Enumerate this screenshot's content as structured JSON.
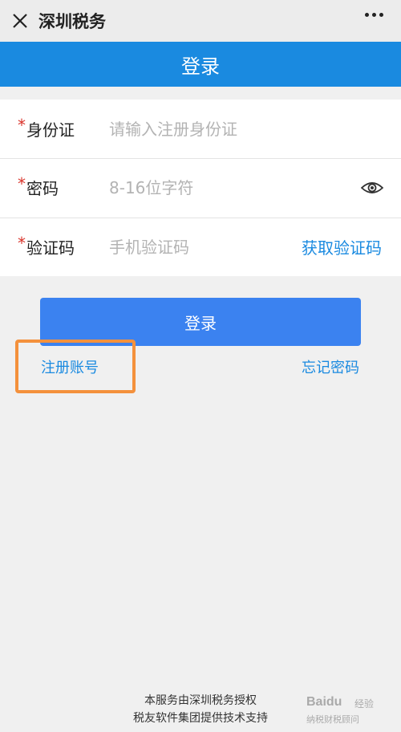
{
  "topbar": {
    "title": "深圳税务"
  },
  "header": {
    "title": "登录"
  },
  "form": {
    "id_label": "身份证",
    "id_placeholder": "请输入注册身份证",
    "password_label": "密码",
    "password_placeholder": "8-16位字符",
    "code_label": "验证码",
    "code_placeholder": "手机验证码",
    "get_code": "获取验证码",
    "required_mark": "*"
  },
  "actions": {
    "login": "登录",
    "register": "注册账号",
    "forgot": "忘记密码"
  },
  "footer": {
    "line1": "本服务由深圳税务授权",
    "line2": "税友软件集团提供技术支持"
  },
  "watermark": {
    "line1": "Baidu",
    "line2": "经验",
    "line3": "纳税财税顾问"
  },
  "colors": {
    "header": "#1a8ae0",
    "button": "#3b82f0",
    "link": "#1a8ae0",
    "required": "#d9342b",
    "highlight": "#f4913c"
  },
  "icons": {
    "close": "close-icon",
    "more": "more-icon",
    "eye": "eye-icon"
  }
}
